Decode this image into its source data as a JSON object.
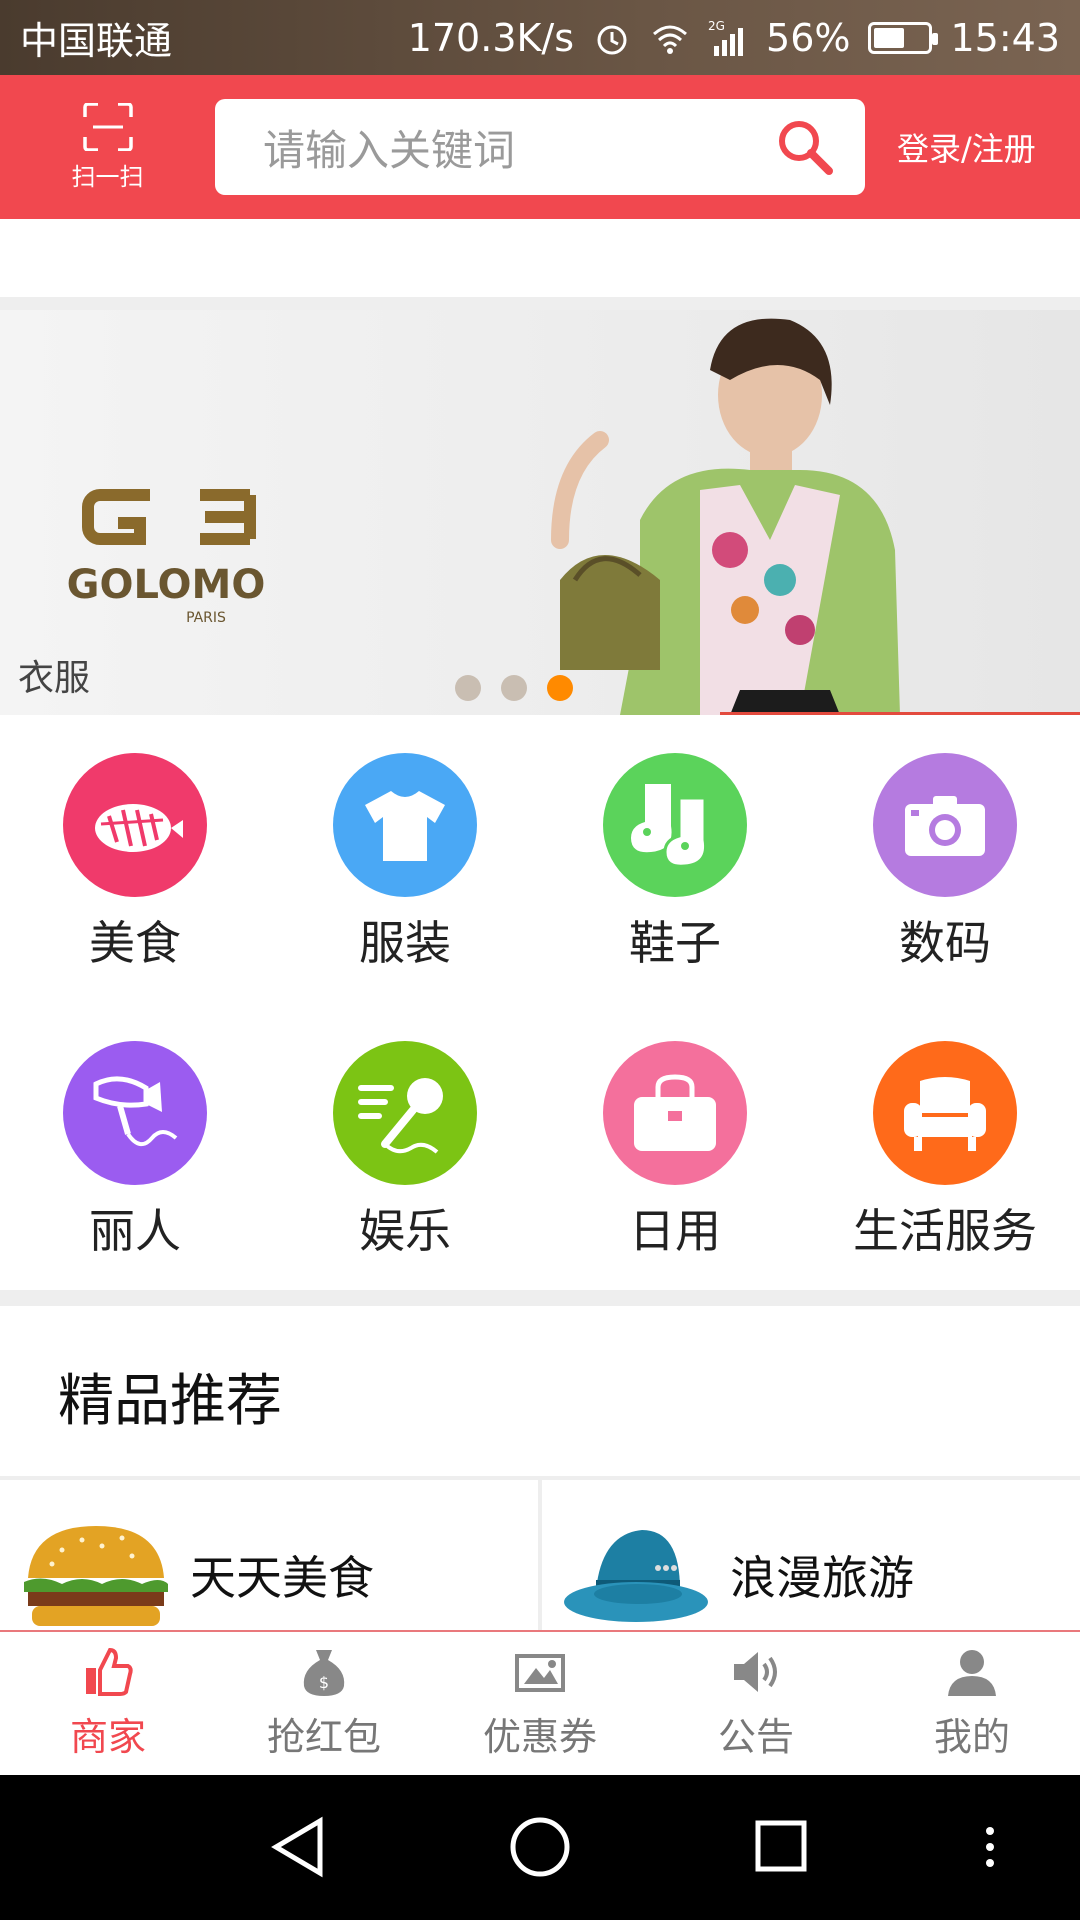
{
  "status_bar": {
    "carrier": "中国联通",
    "speed": "170.3K/s",
    "network": "2G",
    "battery": "56%",
    "battery_level": 0.56,
    "time": "15:43"
  },
  "header": {
    "scan_label": "扫一扫",
    "search_placeholder": "请输入关键词",
    "login_label": "登录/注册",
    "accent_color": "#f1484f"
  },
  "banner": {
    "caption": "衣服",
    "brand_logo": "GOLOMO",
    "brand_sub": "PARIS",
    "dots": 3,
    "active_dot": 3
  },
  "categories": [
    {
      "label": "美食",
      "icon": "food-icon",
      "color": "#f03a6b"
    },
    {
      "label": "服装",
      "icon": "shirt-icon",
      "color": "#4aa8f5"
    },
    {
      "label": "鞋子",
      "icon": "socks-icon",
      "color": "#5bd35b"
    },
    {
      "label": "数码",
      "icon": "camera-icon",
      "color": "#b57be0"
    },
    {
      "label": "丽人",
      "icon": "hair-dryer-icon",
      "color": "#9b5cf0"
    },
    {
      "label": "娱乐",
      "icon": "microphone-icon",
      "color": "#7cc414"
    },
    {
      "label": "日用",
      "icon": "handbag-icon",
      "color": "#f4709c"
    },
    {
      "label": "生活服务",
      "icon": "sofa-icon",
      "color": "#ff6a1a"
    }
  ],
  "recommend": {
    "title": "精品推荐",
    "items": [
      {
        "label": "天天美食",
        "icon": "burger-icon"
      },
      {
        "label": "浪漫旅游",
        "icon": "hat-icon"
      }
    ]
  },
  "tabbar": {
    "items": [
      {
        "label": "商家",
        "icon": "thumbs-up-icon",
        "active": true
      },
      {
        "label": "抢红包",
        "icon": "money-bag-icon",
        "active": false
      },
      {
        "label": "优惠券",
        "icon": "coupon-icon",
        "active": false
      },
      {
        "label": "公告",
        "icon": "speaker-icon",
        "active": false
      },
      {
        "label": "我的",
        "icon": "user-icon",
        "active": false
      }
    ]
  }
}
